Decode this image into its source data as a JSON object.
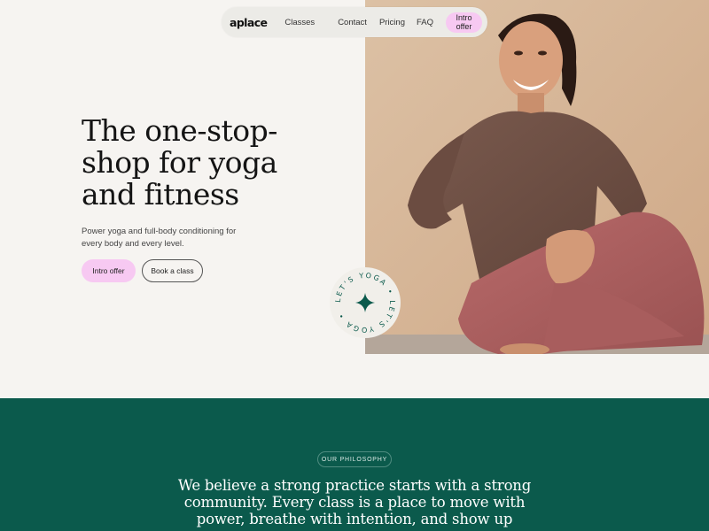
{
  "nav": {
    "logo": "aplace",
    "links": [
      "Classes",
      "Contact",
      "Pricing",
      "FAQ"
    ],
    "cta": "Intro offer"
  },
  "hero": {
    "title": "The one-stop-shop for yoga and fitness",
    "subtitle": "Power yoga and full-body conditioning for every body and every level.",
    "primary_button": "Intro offer",
    "secondary_button": "Book a class"
  },
  "badge": {
    "text": "LET'S YOGA • LET'S YOGA •",
    "icon": "sparkle-star-icon"
  },
  "philosophy": {
    "label": "OUR PHILOSOPHY",
    "statement": "We believe a strong practice starts with a strong community. Every class is a place to move with power, breathe with intention, and show up"
  },
  "colors": {
    "accent_pink": "#f7c9f2",
    "brand_green": "#0b5a4c",
    "background": "#f6f4f1"
  }
}
